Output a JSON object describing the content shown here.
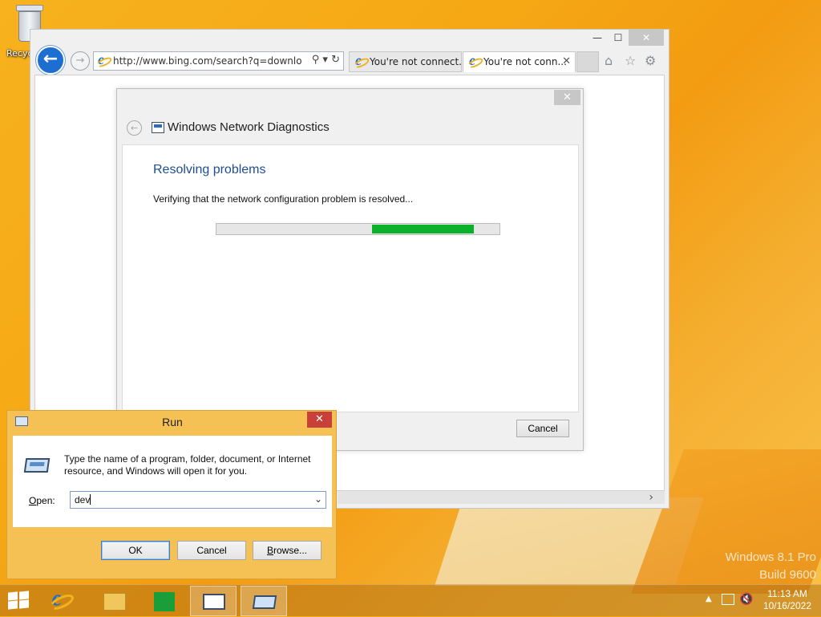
{
  "desktop": {
    "recycle_bin_label": "Recyc",
    "watermark_line1": "Windows 8.1 Pro",
    "watermark_line2": "Build 9600"
  },
  "browser": {
    "minimize": "—",
    "maximize": "☐",
    "close": "✕",
    "back": "←",
    "forward": "→",
    "address_url": "http://www.bing.com/search?q=download+",
    "address_tools": "⚲ ▾ ↻",
    "tabs": [
      {
        "title": "You're not connect...",
        "active": false
      },
      {
        "title": "You're not conn...",
        "active": true,
        "close": "✕"
      }
    ],
    "toolbar_icons": [
      "home-icon",
      "favorites-star-icon",
      "settings-gear-icon"
    ],
    "home_glyph": "⌂",
    "star_glyph": "☆",
    "gear_glyph": "⚙",
    "scroll_right": "›"
  },
  "diagnostics": {
    "title": "Windows Network Diagnostics",
    "close": "✕",
    "back": "←",
    "heading": "Resolving problems",
    "message": "Verifying that the network configuration problem is resolved...",
    "progress": {
      "segment_start": 0.55,
      "segment_end": 0.91,
      "color": "#0bb02b"
    },
    "cancel_label": "Cancel"
  },
  "run_dialog": {
    "title": "Run",
    "close": "✕",
    "description": "Type the name of a program, folder, document, or Internet resource, and Windows will open it for you.",
    "open_label_underline": "O",
    "open_label_rest": "pen:",
    "input_value": "dev",
    "dropdown": "⌄",
    "ok_label": "OK",
    "cancel_label": "Cancel",
    "browse_underline": "B",
    "browse_rest": "rowse..."
  },
  "taskbar": {
    "items": [
      "internet-explorer",
      "file-explorer",
      "store",
      "network-diagnostics",
      "run"
    ],
    "tray_arrow": "▲",
    "volume_glyph": "🔇",
    "time": "11:13 AM",
    "date": "10/16/2022"
  }
}
